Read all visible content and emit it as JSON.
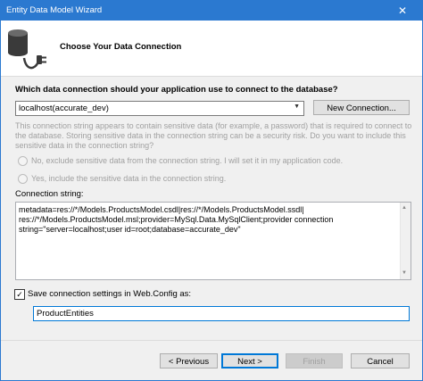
{
  "window": {
    "title": "Entity Data Model Wizard",
    "close_glyph": "✕"
  },
  "header": {
    "heading": "Choose Your Data Connection",
    "icon": "database-plug-icon"
  },
  "connection": {
    "question": "Which data connection should your application use to connect to the database?",
    "selected": "localhost(accurate_dev)",
    "new_connection_label": "New Connection..."
  },
  "sensitive": {
    "notice": "This connection string appears to contain sensitive data (for example, a password) that is required to connect to the database. Storing sensitive data in the connection string can be a security risk. Do you want to include this sensitive data in the connection string?",
    "option_exclude": "No, exclude sensitive data from the connection string. I will set it in my application code.",
    "option_include": "Yes, include the sensitive data in the connection string."
  },
  "connection_string": {
    "label": "Connection string:",
    "line1": "metadata=res://*/Models.ProductsModel.csdl|res://*/Models.ProductsModel.ssdl|",
    "line2": "res://*/Models.ProductsModel.msl;provider=MySql.Data.MySqlClient;provider connection",
    "line3": "string=\"server=localhost;user id=root;database=accurate_dev\""
  },
  "save_settings": {
    "checked": true,
    "check_glyph": "✓",
    "label": "Save connection settings in Web.Config as:",
    "value": "ProductEntities"
  },
  "footer": {
    "previous_label": "< Previous",
    "next_label": "Next >",
    "finish_label": "Finish",
    "cancel_label": "Cancel"
  },
  "colors": {
    "titlebar": "#2b79d0",
    "disabled_text": "#a0a0a0",
    "focus_border": "#0078d7"
  }
}
